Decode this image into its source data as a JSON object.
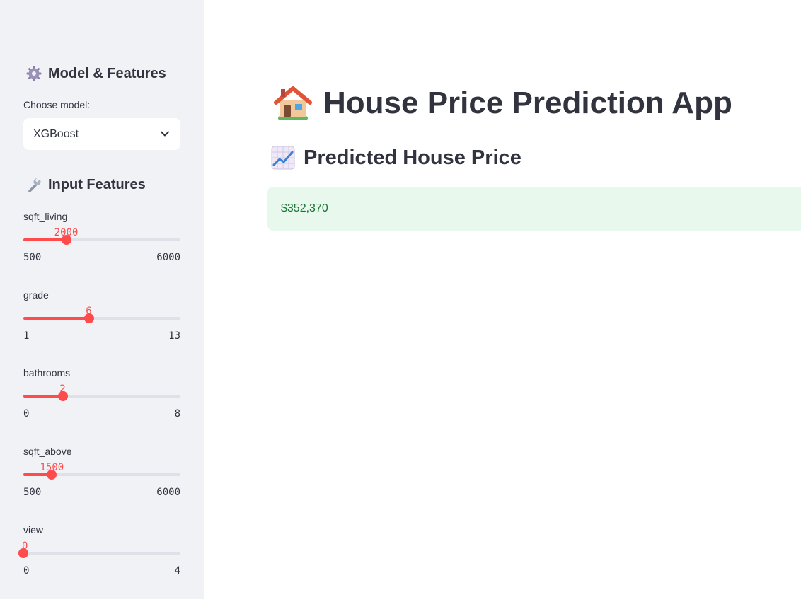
{
  "sidebar": {
    "model_section": {
      "heading": "Model & Features",
      "icon": "gear-icon"
    },
    "model_select": {
      "label": "Choose model:",
      "value": "XGBoost"
    },
    "input_section": {
      "heading": "Input Features",
      "icon": "wrench-icon"
    },
    "sliders": [
      {
        "label": "sqft_living",
        "value": "2000",
        "min": "500",
        "max": "6000",
        "fraction": 0.2727
      },
      {
        "label": "grade",
        "value": "6",
        "min": "1",
        "max": "13",
        "fraction": 0.4167
      },
      {
        "label": "bathrooms",
        "value": "2",
        "min": "0",
        "max": "8",
        "fraction": 0.25
      },
      {
        "label": "sqft_above",
        "value": "1500",
        "min": "500",
        "max": "6000",
        "fraction": 0.1818
      },
      {
        "label": "view",
        "value": "0",
        "min": "0",
        "max": "4",
        "fraction": 0
      }
    ]
  },
  "main": {
    "title": "House Price Prediction App",
    "title_icon": "house-icon",
    "subheading": "Predicted House Price",
    "subheading_icon": "chart-increasing-icon",
    "prediction": "$352,370"
  },
  "colors": {
    "accent": "#ff4b4b",
    "sidebar_bg": "#f0f2f6",
    "success_bg": "#e8f8ed",
    "success_text": "#177233",
    "text": "#31333f"
  }
}
